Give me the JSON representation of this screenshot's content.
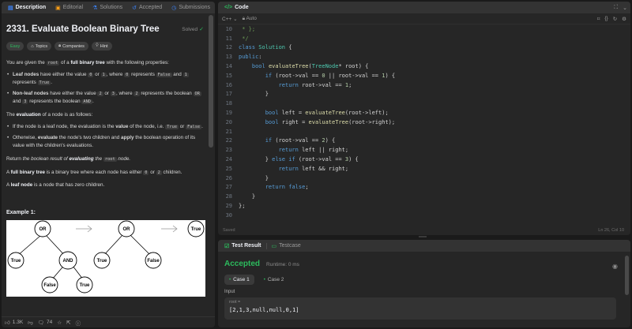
{
  "left": {
    "tabs": [
      {
        "label": "Description",
        "icon": "document-icon"
      },
      {
        "label": "Editorial",
        "icon": "book-icon"
      },
      {
        "label": "Solutions",
        "icon": "flask-icon"
      },
      {
        "label": "Accepted",
        "icon": "history-icon"
      },
      {
        "label": "Submissions",
        "icon": "clock-icon"
      }
    ],
    "title": "2331. Evaluate Boolean Binary Tree",
    "solved": "Solved",
    "chips": {
      "easy": "Easy",
      "topics": "Topics",
      "companies": "Companies",
      "hint": "Hint"
    },
    "desc": {
      "p1a": "You are given the ",
      "p1code": "root",
      "p1b": " of a ",
      "p1bold": "full binary tree",
      "p1c": " with the following properties:",
      "b1bold": "Leaf nodes",
      "b1a": " have either the value ",
      "b1c0": "0",
      "b1b": " or ",
      "b1c1": "1",
      "b1c": ", where ",
      "b1c0b": "0",
      "b1d": " represents ",
      "b1false": "False",
      "b1e": " and ",
      "b1c1b": "1",
      "b1f": " represents ",
      "b1true": "True",
      "b1g": ".",
      "b2bold": "Non-leaf nodes",
      "b2a": " have either the value ",
      "b2c2": "2",
      "b2b": " or ",
      "b2c3": "3",
      "b2c": ", where ",
      "b2c2b": "2",
      "b2d": " represents the boolean ",
      "b2or": "OR",
      "b2e": " and ",
      "b2c3b": "3",
      "b2f": " represents the boolean ",
      "b2and": "AND",
      "b2g": ".",
      "p2a": "The ",
      "p2bold": "evaluation",
      "p2b": " of a node is as follows:",
      "b3a": "If the node is a leaf node, the evaluation is the ",
      "b3bold": "value",
      "b3b": " of the node, i.e. ",
      "b3true": "True",
      "b3c": " or ",
      "b3false": "False",
      "b3d": ".",
      "b4a": "Otherwise, ",
      "b4bold1": "evaluate",
      "b4b": " the node's two children and ",
      "b4bold2": "apply",
      "b4c": " the boolean operation of its value with the children's evaluations.",
      "p3a": "Return ",
      "p3i": "the boolean result of ",
      "p3bi": "evaluating",
      "p3b": " the ",
      "p3code": "root",
      "p3c": " node.",
      "p4a": "A ",
      "p4bold": "full binary tree",
      "p4b": " is a binary tree where each node has either ",
      "p4c0": "0",
      "p4c": " or ",
      "p4c2": "2",
      "p4d": " children.",
      "p5a": "A ",
      "p5bold": "leaf node",
      "p5b": " is a node that has zero children."
    },
    "example_title": "Example 1:",
    "tree_labels": {
      "or1": "OR",
      "true1": "True",
      "and": "AND",
      "false1": "False",
      "true2": "True",
      "or2": "OR",
      "true3": "True",
      "false2": "False",
      "true4": "True"
    },
    "footer": {
      "likes": "1.3K",
      "comments": "74"
    }
  },
  "code": {
    "tab": "Code",
    "lang": "C++",
    "mode": "Auto",
    "status_left": "Saved",
    "status_right": "Ln 26, Col 10",
    "lines": [
      {
        "n": "10",
        "t": " * };"
      },
      {
        "n": "11",
        "t": " */"
      },
      {
        "n": "12",
        "t": "class Solution {"
      },
      {
        "n": "13",
        "t": "public:"
      },
      {
        "n": "14",
        "t": "    bool evaluateTree(TreeNode* root) {"
      },
      {
        "n": "15",
        "t": "        if (root->val == 0 || root->val == 1) {"
      },
      {
        "n": "16",
        "t": "            return root->val == 1;"
      },
      {
        "n": "17",
        "t": "        }"
      },
      {
        "n": "18",
        "t": ""
      },
      {
        "n": "19",
        "t": "        bool left = evaluateTree(root->left);"
      },
      {
        "n": "20",
        "t": "        bool right = evaluateTree(root->right);"
      },
      {
        "n": "21",
        "t": ""
      },
      {
        "n": "22",
        "t": "        if (root->val == 2) {"
      },
      {
        "n": "23",
        "t": "            return left || right;"
      },
      {
        "n": "24",
        "t": "        } else if (root->val == 3) {"
      },
      {
        "n": "25",
        "t": "            return left && right;"
      },
      {
        "n": "26",
        "t": "        }"
      },
      {
        "n": "27",
        "t": "        return false;"
      },
      {
        "n": "28",
        "t": "    }"
      },
      {
        "n": "29",
        "t": "};"
      },
      {
        "n": "30",
        "t": ""
      }
    ]
  },
  "result": {
    "tabs": [
      {
        "label": "Test Result"
      },
      {
        "label": "Testcase"
      }
    ],
    "accepted": "Accepted",
    "runtime": "Runtime: 0 ms",
    "cases": [
      "Case 1",
      "Case 2"
    ],
    "input_label": "Input",
    "input_name": "root =",
    "input_value": "[2,1,3,null,null,0,1]"
  },
  "colors": {
    "accent_green": "#2cbb5d",
    "bg": "#1a1a1a",
    "panel": "#262626"
  }
}
